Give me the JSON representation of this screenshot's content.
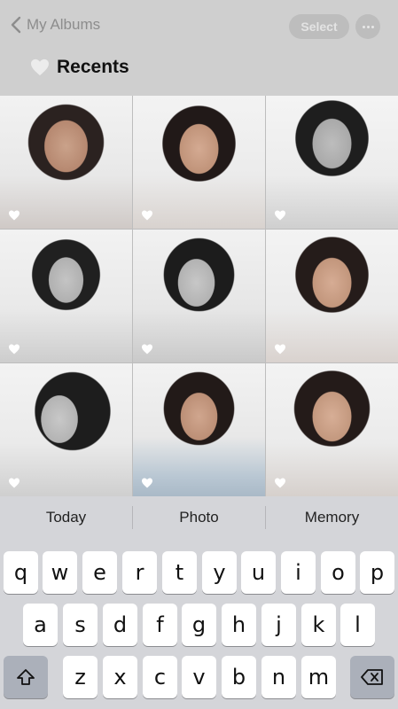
{
  "nav": {
    "back_label": "My Albums",
    "select_label": "Select"
  },
  "title": "Recents",
  "photos": [
    {
      "favorite": true
    },
    {
      "favorite": true
    },
    {
      "favorite": true
    },
    {
      "favorite": true
    },
    {
      "favorite": true
    },
    {
      "favorite": true
    },
    {
      "favorite": true
    },
    {
      "favorite": true
    },
    {
      "favorite": true
    }
  ],
  "suggestions": [
    "Today",
    "Photo",
    "Memory"
  ],
  "keyboard": {
    "row1": [
      "q",
      "w",
      "e",
      "r",
      "t",
      "y",
      "u",
      "i",
      "o",
      "p"
    ],
    "row2": [
      "a",
      "s",
      "d",
      "f",
      "g",
      "h",
      "j",
      "k",
      "l"
    ],
    "row3": [
      "z",
      "x",
      "c",
      "v",
      "b",
      "n",
      "m"
    ]
  },
  "colors": {
    "nav_bg": "#cfcfcf",
    "keyboard_bg": "#d4d5d9",
    "func_key": "#abb0ba"
  }
}
